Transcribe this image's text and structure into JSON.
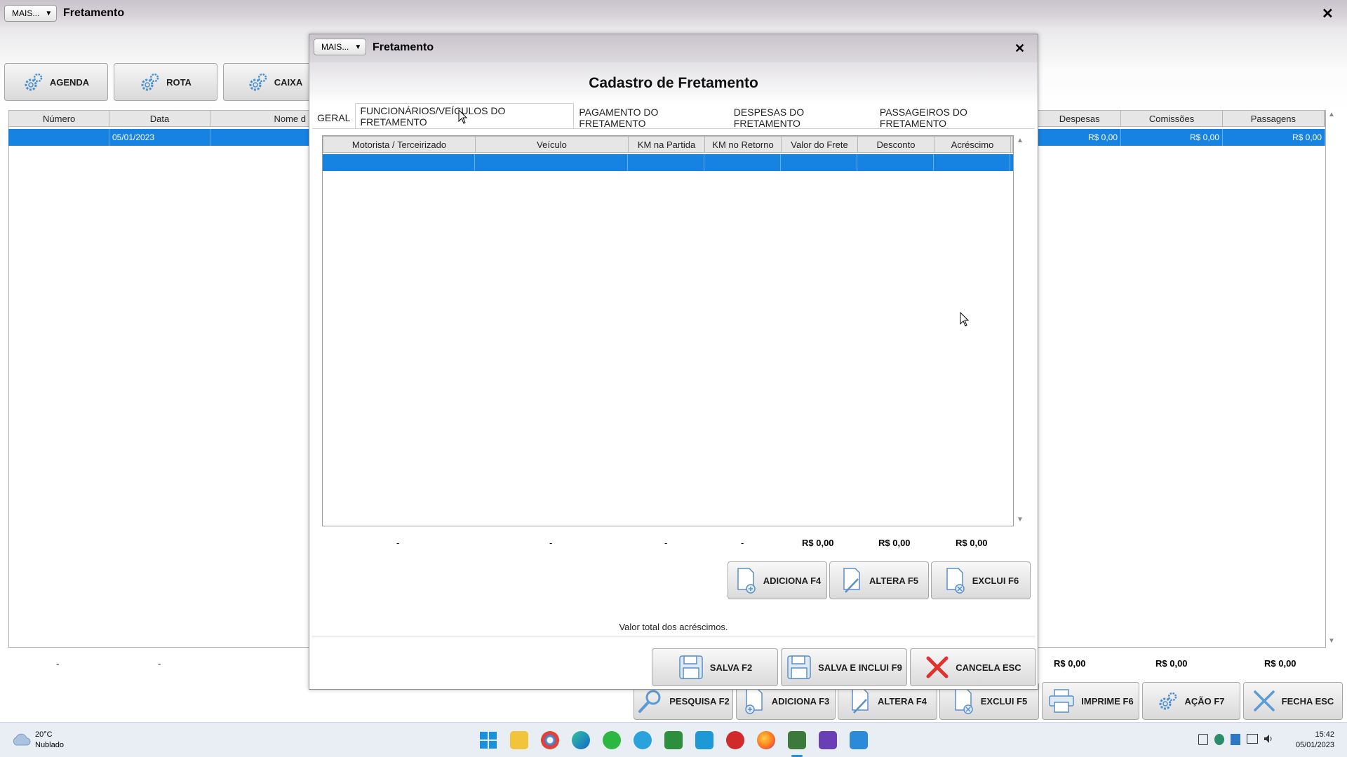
{
  "main_window": {
    "mais_label": "MAIS...",
    "title": "Fretamento",
    "close_glyph": "✕",
    "toolbar": {
      "agenda": "AGENDA",
      "rota": "ROTA",
      "caixa": "CAIXA"
    },
    "grid": {
      "columns_left": [
        "Número",
        "Data",
        "Nome d"
      ],
      "columns_right": [
        "Despesas",
        "Comissões",
        "Passagens"
      ],
      "row": {
        "numero": "",
        "data": "05/01/2023",
        "despesas": "R$ 0,00",
        "comissoes": "R$ 0,00",
        "passagens": "R$ 0,00"
      }
    },
    "totals": {
      "numero": "-",
      "data": "-",
      "despesas": "R$ 0,00",
      "comissoes": "R$ 0,00",
      "passagens": "R$ 0,00"
    },
    "bottom_buttons": {
      "pesquisa": "PESQUISA F2",
      "adiciona": "ADICIONA F3",
      "altera": "ALTERA F4",
      "exclui": "EXCLUI F5",
      "imprime": "IMPRIME F6",
      "acao": "AÇÃO F7",
      "fecha": "FECHA ESC"
    }
  },
  "dialog": {
    "mais_label": "MAIS...",
    "title": "Fretamento",
    "close_glyph": "✕",
    "heading": "Cadastro de Fretamento",
    "tabs": [
      "GERAL",
      "FUNCIONÁRIOS/VEÍCULOS DO FRETAMENTO",
      "PAGAMENTO DO FRETAMENTO",
      "DESPESAS DO FRETAMENTO",
      "PASSAGEIROS DO FRETAMENTO"
    ],
    "active_tab_index": 1,
    "grid": {
      "columns": [
        "Motorista / Terceirizado",
        "Veículo",
        "KM na Partida",
        "KM no Retorno",
        "Valor do Frete",
        "Desconto",
        "Acréscimo"
      ]
    },
    "totals": [
      "-",
      "-",
      "-",
      "-",
      "R$ 0,00",
      "R$ 0,00",
      "R$ 0,00"
    ],
    "item_buttons": {
      "adiciona": "ADICIONA F4",
      "altera": "ALTERA F5",
      "exclui": "EXCLUI F6"
    },
    "hint": "Valor total dos acréscimos.",
    "footer_buttons": {
      "salva": "SALVA F2",
      "salva_inclui": "SALVA E INCLUI F9",
      "cancela": "CANCELA ESC"
    }
  },
  "taskbar": {
    "weather_temp": "20°C",
    "weather_desc": "Nublado",
    "time": "15:42",
    "date": "05/01/2023",
    "apps": [
      "windows-start",
      "file-explorer",
      "chrome",
      "edge",
      "whatsapp",
      "telegram",
      "spreadsheet-app",
      "mail-app",
      "app-red",
      "firefox",
      "app-sg",
      "app-purple",
      "app-blue"
    ]
  },
  "colors": {
    "selection_blue": "#1683e3",
    "title_gradient": "#c9c4cb",
    "cancel_red": "#e0312d"
  }
}
